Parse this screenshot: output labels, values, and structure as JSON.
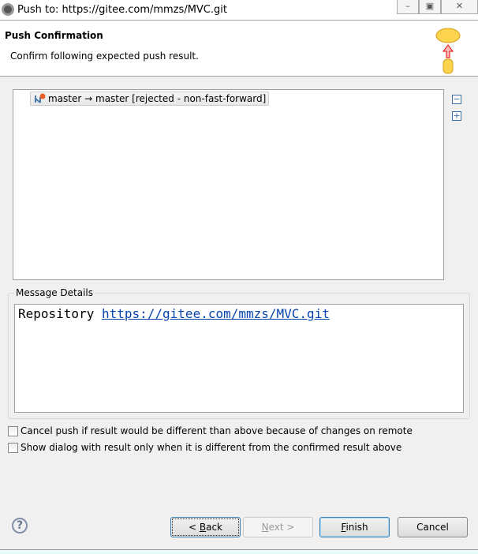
{
  "window": {
    "title": "Push to: https://gitee.com/mmzs/MVC.git",
    "minimize": "–",
    "maximize": "▣",
    "close": "✕"
  },
  "header": {
    "title": "Push Confirmation",
    "description": "Confirm following expected push result."
  },
  "tree": {
    "items": [
      {
        "label": "master → master [rejected - non-fast-forward]"
      }
    ],
    "collapse_all": "−",
    "expand_all": "+"
  },
  "message": {
    "group_label": "Message Details",
    "prefix": "Repository ",
    "link": "https://gitee.com/mmzs/MVC.git"
  },
  "options": [
    {
      "label": "Cancel push if result would be different than above because of changes on remote",
      "checked": false
    },
    {
      "label": "Show dialog with result only when it is different from the confirmed result above",
      "checked": false
    }
  ],
  "footer": {
    "help": "?",
    "back_pre": "< ",
    "back_u": "B",
    "back_post": "ack",
    "next_u": "N",
    "next_post": "ext >",
    "finish_u": "F",
    "finish_post": "inish",
    "cancel": "Cancel"
  }
}
